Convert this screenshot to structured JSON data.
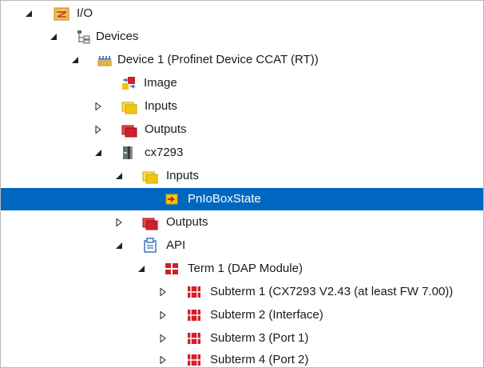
{
  "tree": {
    "items": [
      {
        "label": "I/O",
        "expander": "expanded",
        "icon": "io-folder-icon"
      },
      {
        "label": "Devices",
        "expander": "expanded",
        "icon": "devices-icon"
      },
      {
        "label": "Device 1 (Profinet Device CCAT (RT))",
        "expander": "expanded",
        "icon": "profinet-device-icon"
      },
      {
        "label": "Image",
        "expander": "none",
        "icon": "image-icon"
      },
      {
        "label": "Inputs",
        "expander": "collapsed",
        "icon": "inputs-icon"
      },
      {
        "label": "Outputs",
        "expander": "collapsed",
        "icon": "outputs-icon"
      },
      {
        "label": "cx7293",
        "expander": "expanded",
        "icon": "controller-icon"
      },
      {
        "label": "Inputs",
        "expander": "expanded",
        "icon": "inputs-icon"
      },
      {
        "label": "PnIoBoxState",
        "expander": "none",
        "icon": "variable-icon",
        "selected": true
      },
      {
        "label": "Outputs",
        "expander": "collapsed",
        "icon": "outputs-icon"
      },
      {
        "label": "API",
        "expander": "expanded",
        "icon": "api-icon"
      },
      {
        "label": "Term 1 (DAP Module)",
        "expander": "expanded",
        "icon": "module-icon"
      },
      {
        "label": "Subterm 1 (CX7293 V2.43 (at least FW 7.00))",
        "expander": "collapsed",
        "icon": "submodule-icon"
      },
      {
        "label": "Subterm 2 (Interface)",
        "expander": "collapsed",
        "icon": "submodule-icon"
      },
      {
        "label": "Subterm 3 (Port 1)",
        "expander": "collapsed",
        "icon": "submodule-icon"
      },
      {
        "label": "Subterm 4 (Port 2)",
        "expander": "collapsed",
        "icon": "submodule-icon"
      }
    ]
  },
  "colors": {
    "selection": "#0067c0",
    "text": "#1a1a1a",
    "inputs": "#f2c511",
    "outputs": "#d0202a"
  }
}
